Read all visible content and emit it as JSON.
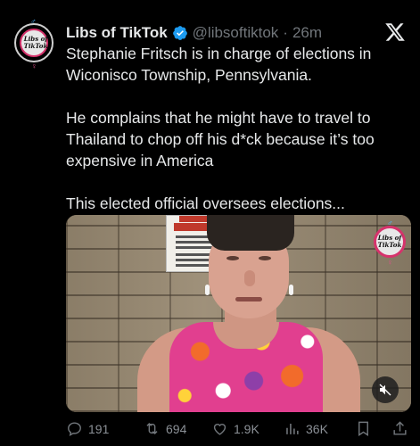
{
  "tweet": {
    "author_name": "Libs of TikTok",
    "handle": "@libsoftiktok",
    "separator": "·",
    "time": "26m",
    "paragraphs": [
      "Stephanie Fritsch is in charge of elections in Wiconisco Township, Pennsylvania.",
      "He complains that he might have to travel to Thailand to chop off his d*ck because it’s too expensive in America",
      "This elected official oversees elections..."
    ],
    "avatar_text": "Libs of TikTok"
  },
  "media": {
    "watermark_text": "Libs of TikTok"
  },
  "actions": {
    "replies": "191",
    "reposts": "694",
    "likes": "1.9K",
    "views": "36K"
  },
  "colors": {
    "background": "#000000",
    "text": "#e7e9ea",
    "secondary_text": "#71767b",
    "verified": "#1d9bf0",
    "avatar_ring": "#d6336c"
  },
  "icons": [
    "verified-icon",
    "x-logo-icon",
    "reply-icon",
    "repost-icon",
    "like-icon",
    "views-icon",
    "bookmark-icon",
    "share-icon",
    "mute-icon"
  ]
}
